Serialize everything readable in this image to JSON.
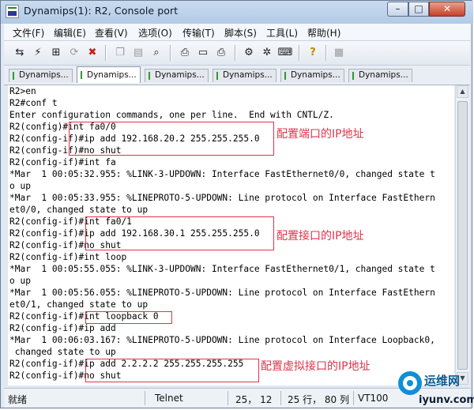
{
  "window": {
    "title": "Dynamips(1): R2, Console port"
  },
  "menu": [
    "文件(F)",
    "编辑(E)",
    "查看(V)",
    "选项(O)",
    "传输(T)",
    "脚本(S)",
    "工具(L)",
    "帮助(H)"
  ],
  "tabs": [
    {
      "label": "Dynamips..."
    },
    {
      "label": "Dynamips..."
    },
    {
      "label": "Dynamips..."
    },
    {
      "label": "Dynamips..."
    },
    {
      "label": "Dynamips..."
    },
    {
      "label": "Dynamips..."
    }
  ],
  "console": {
    "lines": [
      "R2>en",
      "R2#conf t",
      "Enter configuration commands, one per line.  End with CNTL/Z.",
      "R2(config)#int fa0/0",
      "R2(config-if)#ip add 192.168.20.2 255.255.255.0",
      "R2(config-if)#no shut",
      "R2(config-if)#int fa",
      "*Mar  1 00:05:32.955: %LINK-3-UPDOWN: Interface FastEthernet0/0, changed state t",
      "o up",
      "*Mar  1 00:05:33.955: %LINEPROTO-5-UPDOWN: Line protocol on Interface FastEthern",
      "et0/0, changed state to up",
      "R2(config-if)#int fa0/1",
      "R2(config-if)#ip add 192.168.30.1 255.255.255.0",
      "R2(config-if)#no shut",
      "R2(config-if)#int loop",
      "*Mar  1 00:05:55.055: %LINK-3-UPDOWN: Interface FastEthernet0/1, changed state t",
      "o up",
      "*Mar  1 00:05:56.055: %LINEPROTO-5-UPDOWN: Line protocol on Interface FastEthern",
      "et0/1, changed state to up",
      "R2(config-if)#int loopback 0",
      "R2(config-if)#ip add",
      "*Mar  1 00:06:03.167: %LINEPROTO-5-UPDOWN: Line protocol on Interface Loopback0,",
      " changed state to up",
      "R2(config-if)#ip add 2.2.2.2 255.255.255.255",
      "R2(config-if)#no shut"
    ]
  },
  "annotations": [
    "配置端口的IP地址",
    "配置接口的IP地址",
    "配置虚拟接口的IP地址"
  ],
  "status": {
    "ready": "就绪",
    "protocol": "Telnet",
    "cursor": "25， 12",
    "position": "25 行， 80 列",
    "terminal": "VT100"
  },
  "watermark": {
    "brand": "运维网",
    "url": "iyunv.com"
  },
  "colors": {
    "annotation": "#e0334a",
    "titlebar": "#c9dbef",
    "tab_marker": "#2f9a2f"
  },
  "icons": [
    "connect-icon",
    "quick-connect-icon",
    "connect-tab-icon",
    "reconnect-icon",
    "disconnect-icon",
    "copy-icon",
    "paste-icon",
    "find-icon",
    "print-icon",
    "print-setup-icon",
    "print-icon",
    "session-options-icon",
    "global-options-icon",
    "keymap-icon",
    "help-icon",
    "log-icon"
  ]
}
